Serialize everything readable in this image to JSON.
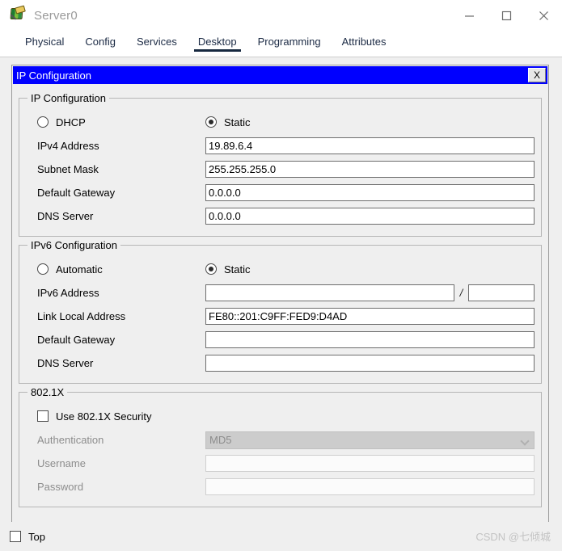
{
  "window": {
    "title": "Server0",
    "icon": "server-package-icon",
    "controls": {
      "minimize": "minimize-icon",
      "maximize": "maximize-icon",
      "close": "close-icon"
    }
  },
  "tabs": [
    {
      "label": "Physical",
      "active": false
    },
    {
      "label": "Config",
      "active": false
    },
    {
      "label": "Services",
      "active": false
    },
    {
      "label": "Desktop",
      "active": true
    },
    {
      "label": "Programming",
      "active": false
    },
    {
      "label": "Attributes",
      "active": false
    }
  ],
  "dialog": {
    "title": "IP Configuration",
    "close_label": "X",
    "accent_color": "#0000ff"
  },
  "ipv4": {
    "group_label": "IP Configuration",
    "mode_dhcp_label": "DHCP",
    "mode_static_label": "Static",
    "mode_dhcp_selected": false,
    "mode_static_selected": true,
    "fields": [
      {
        "label": "IPv4 Address",
        "value": "19.89.6.4"
      },
      {
        "label": "Subnet Mask",
        "value": "255.255.255.0"
      },
      {
        "label": "Default Gateway",
        "value": "0.0.0.0"
      },
      {
        "label": "DNS Server",
        "value": "0.0.0.0"
      }
    ]
  },
  "ipv6": {
    "group_label": "IPv6 Configuration",
    "mode_auto_label": "Automatic",
    "mode_static_label": "Static",
    "mode_auto_selected": false,
    "mode_static_selected": true,
    "address_label": "IPv6 Address",
    "address_value": "",
    "prefix_separator": "/",
    "prefix_value": "",
    "fields": [
      {
        "label": "Link Local Address",
        "value": "FE80::201:C9FF:FED9:D4AD"
      },
      {
        "label": "Default Gateway",
        "value": ""
      },
      {
        "label": "DNS Server",
        "value": ""
      }
    ]
  },
  "dot1x": {
    "group_label": "802.1X",
    "use_security_label": "Use 802.1X Security",
    "use_security_checked": false,
    "authentication_label": "Authentication",
    "authentication_value": "MD5",
    "username_label": "Username",
    "username_value": "",
    "password_label": "Password",
    "password_value": ""
  },
  "footer": {
    "top_label": "Top",
    "top_checked": false,
    "watermark": "CSDN @七倾城"
  }
}
